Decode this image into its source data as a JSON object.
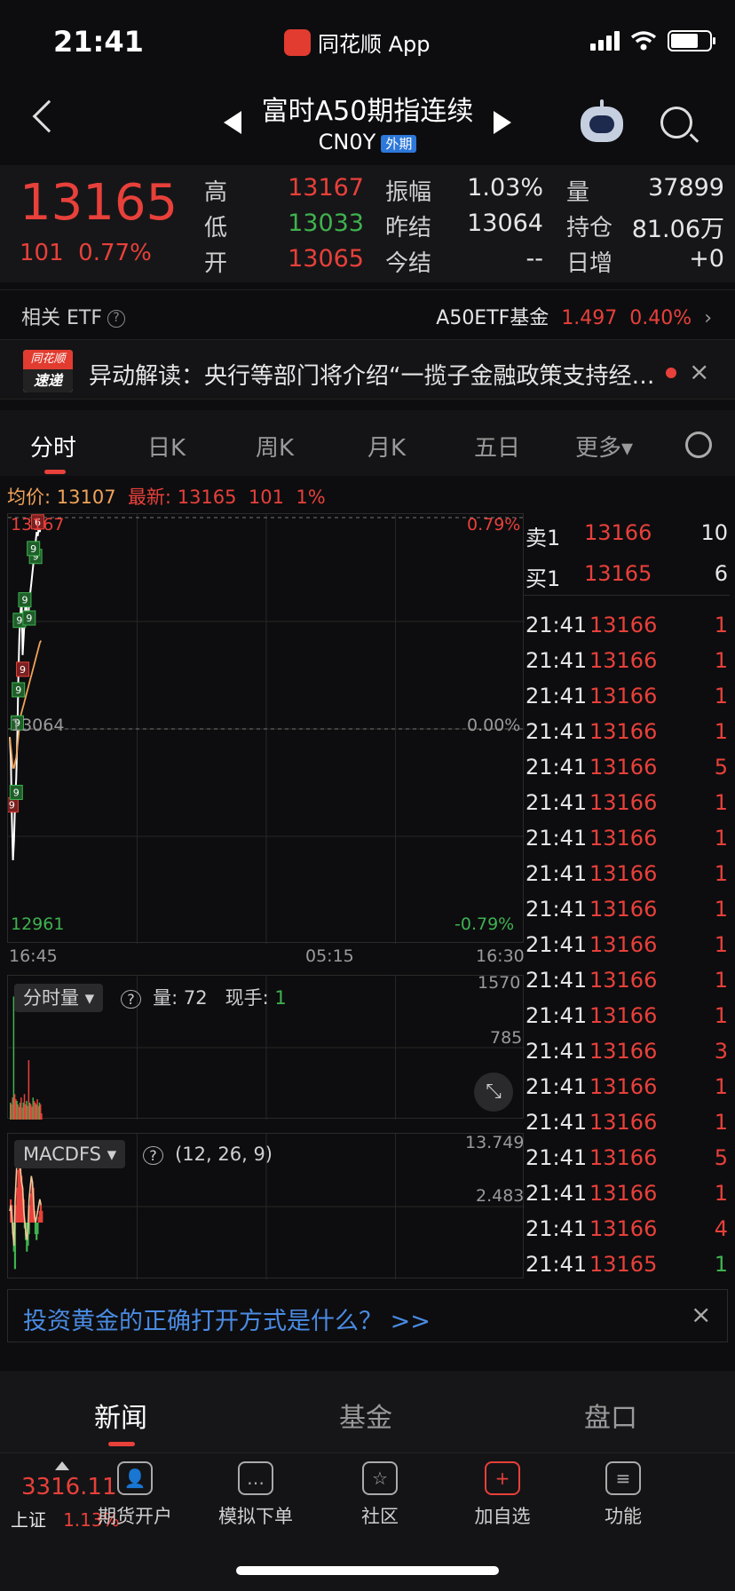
{
  "status": {
    "time": "21:41",
    "app_name": "同花顺 App"
  },
  "nav": {
    "title": "富时A50期指连续",
    "code": "CN0Y",
    "tag": "外期"
  },
  "quote": {
    "last": "13165",
    "change": "101",
    "change_pct": "0.77%",
    "rows": [
      [
        {
          "l": "高",
          "v": "13167",
          "c": "red"
        },
        {
          "l": "振幅",
          "v": "1.03%",
          "c": "white"
        },
        {
          "l": "量",
          "v": "37899",
          "c": "white"
        }
      ],
      [
        {
          "l": "低",
          "v": "13033",
          "c": "green"
        },
        {
          "l": "昨结",
          "v": "13064",
          "c": "white"
        },
        {
          "l": "持仓",
          "v": "81.06万",
          "c": "white"
        }
      ],
      [
        {
          "l": "开",
          "v": "13065",
          "c": "red"
        },
        {
          "l": "今结",
          "v": "--",
          "c": "white"
        },
        {
          "l": "日增",
          "v": "+0",
          "c": "white"
        }
      ]
    ]
  },
  "etf": {
    "label": "相关 ETF",
    "name": "A50ETF基金",
    "price": "1.497",
    "pct": "0.40%",
    "arrow": "›"
  },
  "news": {
    "badge_top": "同花顺",
    "badge_bottom": "速递",
    "text": "异动解读：央行等部门将介绍“一揽子金融政策支持经济高质量发展”",
    "close": "×"
  },
  "tabs": [
    "分时",
    "日K",
    "周K",
    "月K",
    "五日",
    "更多▾"
  ],
  "avg_line": {
    "avg_label": "均价:",
    "avg": "13107",
    "last_label": "最新:",
    "last": "13165",
    "chg": "101",
    "pct": "1%"
  },
  "main_chart": {
    "y_top": "13167",
    "y_mid": "13064",
    "y_bot": "12961",
    "pct_top": "0.79%",
    "pct_mid": "0.00%",
    "pct_bot": "-0.79%",
    "x_labels": [
      "16:45",
      "05:15",
      "16:30"
    ],
    "markers": [
      "9",
      "9",
      "9",
      "9",
      "9",
      "9",
      "9",
      "9",
      "6",
      "9",
      "9"
    ]
  },
  "chart_data": [
    {
      "type": "line",
      "title": "",
      "ylim": [
        12961,
        13167
      ],
      "series": [
        {
          "values": [
            13060,
            13050,
            13020,
            13000,
            13010,
            13030,
            13040,
            13060,
            13090,
            13110,
            13120,
            13130,
            13100,
            13110,
            13120,
            13130,
            13120,
            13115,
            13125,
            13130,
            13135,
            13140,
            13145,
            13150,
            13155,
            13160,
            13158,
            13162,
            13160,
            13165
          ]
        },
        {
          "values": [
            13060,
            13055,
            13050,
            13045,
            13045,
            13048,
            13050,
            13055,
            13060,
            13065,
            13070,
            13072,
            13074,
            13076,
            13078,
            13080,
            13082,
            13084,
            13086,
            13088,
            13090,
            13092,
            13094,
            13096,
            13098,
            13100,
            13102,
            13104,
            13106,
            13107
          ]
        }
      ]
    },
    {
      "type": "bar",
      "title": "",
      "ylim": [
        0,
        1570
      ],
      "values": [
        200,
        180,
        260,
        1450,
        300,
        240,
        220,
        180,
        150,
        200,
        260,
        140,
        200,
        300,
        180,
        220,
        160,
        700,
        200,
        180,
        150,
        260,
        220,
        200,
        180,
        240,
        160,
        200,
        180,
        72
      ]
    },
    {
      "type": "bar",
      "title": "",
      "ylim": [
        -13.749,
        13.749
      ],
      "values": [
        4,
        3,
        -2,
        -5,
        -8,
        3,
        6,
        9,
        12,
        10,
        8,
        6,
        4,
        -1,
        -3,
        -5,
        -4,
        -2,
        3,
        5,
        7,
        6,
        2,
        -2,
        -3,
        -2,
        1,
        2,
        3,
        2
      ],
      "series": [
        {
          "values": [
            2,
            3,
            1,
            -2,
            -4,
            4,
            8,
            12,
            13,
            11,
            9,
            7,
            6,
            2,
            0,
            -2,
            -3,
            -1,
            4,
            6,
            8,
            7,
            4,
            1,
            0,
            1,
            2,
            3,
            4,
            3
          ]
        }
      ]
    }
  ],
  "vol": {
    "chip": "分时量 ▾",
    "help": "?",
    "label": "量:",
    "value": "72",
    "label2": "现手:",
    "value2": "1",
    "y_top": "1570",
    "y_mid": "785"
  },
  "macd": {
    "chip": "MACDFS ▾",
    "help": "?",
    "params": "(12, 26, 9)",
    "y_top": "13.749",
    "y_mid": "2.483"
  },
  "orderbook": {
    "sell": {
      "label": "卖1",
      "price": "13166",
      "qty": "10"
    },
    "buy": {
      "label": "买1",
      "price": "13165",
      "qty": "6"
    },
    "ticks": [
      {
        "t": "21:41",
        "p": "13166",
        "q": "1",
        "c": "red"
      },
      {
        "t": "21:41",
        "p": "13166",
        "q": "1",
        "c": "red"
      },
      {
        "t": "21:41",
        "p": "13166",
        "q": "1",
        "c": "red"
      },
      {
        "t": "21:41",
        "p": "13166",
        "q": "1",
        "c": "red"
      },
      {
        "t": "21:41",
        "p": "13166",
        "q": "5",
        "c": "red"
      },
      {
        "t": "21:41",
        "p": "13166",
        "q": "1",
        "c": "red"
      },
      {
        "t": "21:41",
        "p": "13166",
        "q": "1",
        "c": "red"
      },
      {
        "t": "21:41",
        "p": "13166",
        "q": "1",
        "c": "red"
      },
      {
        "t": "21:41",
        "p": "13166",
        "q": "1",
        "c": "red"
      },
      {
        "t": "21:41",
        "p": "13166",
        "q": "1",
        "c": "red"
      },
      {
        "t": "21:41",
        "p": "13166",
        "q": "1",
        "c": "red"
      },
      {
        "t": "21:41",
        "p": "13166",
        "q": "1",
        "c": "red"
      },
      {
        "t": "21:41",
        "p": "13166",
        "q": "3",
        "c": "red"
      },
      {
        "t": "21:41",
        "p": "13166",
        "q": "1",
        "c": "red"
      },
      {
        "t": "21:41",
        "p": "13166",
        "q": "1",
        "c": "red"
      },
      {
        "t": "21:41",
        "p": "13166",
        "q": "5",
        "c": "red"
      },
      {
        "t": "21:41",
        "p": "13166",
        "q": "1",
        "c": "red"
      },
      {
        "t": "21:41",
        "p": "13166",
        "q": "4",
        "c": "red"
      },
      {
        "t": "21:41",
        "p": "13165",
        "q": "1",
        "c": "green"
      }
    ]
  },
  "promo": {
    "text": "投资黄金的正确打开方式是什么？ >>",
    "close": "×"
  },
  "bottom_tabs": [
    "新闻",
    "基金",
    "盘口"
  ],
  "toolbar": {
    "index_price": "3316.11",
    "index_name": "上证",
    "index_pct": "1.13%",
    "items": [
      {
        "label": "期货开户",
        "icon": "person-icon",
        "glyph": "👤"
      },
      {
        "label": "模拟下单",
        "icon": "document-icon",
        "glyph": "…"
      },
      {
        "label": "社区",
        "icon": "star-icon",
        "glyph": "☆"
      },
      {
        "label": "加自选",
        "icon": "plus-icon",
        "glyph": "+"
      },
      {
        "label": "功能",
        "icon": "menu-icon",
        "glyph": "≡"
      }
    ]
  },
  "colors": {
    "up": "#e8403a",
    "down": "#3fb24f",
    "avg": "#f0a35a",
    "price_line": "#ffffff",
    "accent": "#4a8be3"
  }
}
